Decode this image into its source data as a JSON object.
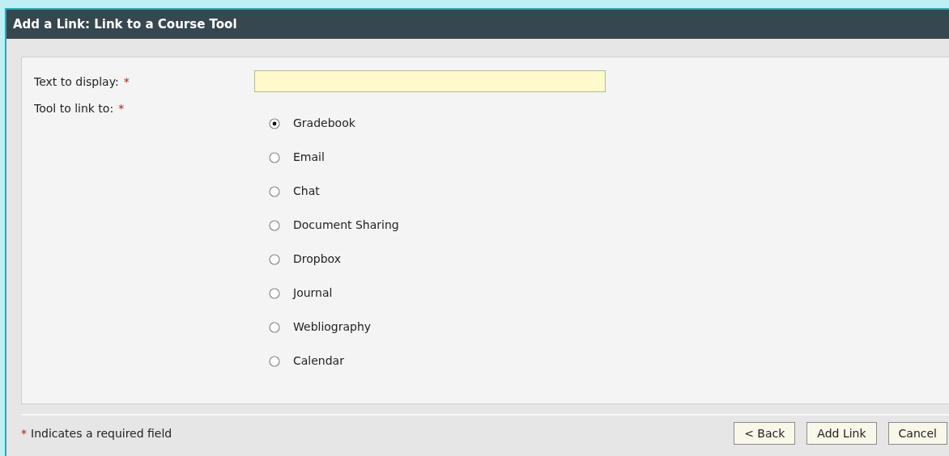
{
  "window": {
    "title": "Add a Link: Link to a Course Tool"
  },
  "fields": [
    {
      "kind": "text",
      "label": "Text to display:",
      "required_mark": "*"
    },
    {
      "kind": "radio",
      "label": "Tool to link to:",
      "required_mark": "*",
      "options": [
        {
          "label": "Gradebook",
          "selected": true
        },
        {
          "label": "Email",
          "selected": false
        },
        {
          "label": "Chat",
          "selected": false
        },
        {
          "label": "Document Sharing",
          "selected": false
        },
        {
          "label": "Dropbox",
          "selected": false
        },
        {
          "label": "Journal",
          "selected": false
        },
        {
          "label": "Webliography",
          "selected": false
        },
        {
          "label": "Calendar",
          "selected": false
        }
      ]
    }
  ],
  "footer": {
    "note_mark": "*",
    "note": "Indicates a required field",
    "buttons": [
      "< Back",
      "Add Link",
      "Cancel"
    ]
  }
}
